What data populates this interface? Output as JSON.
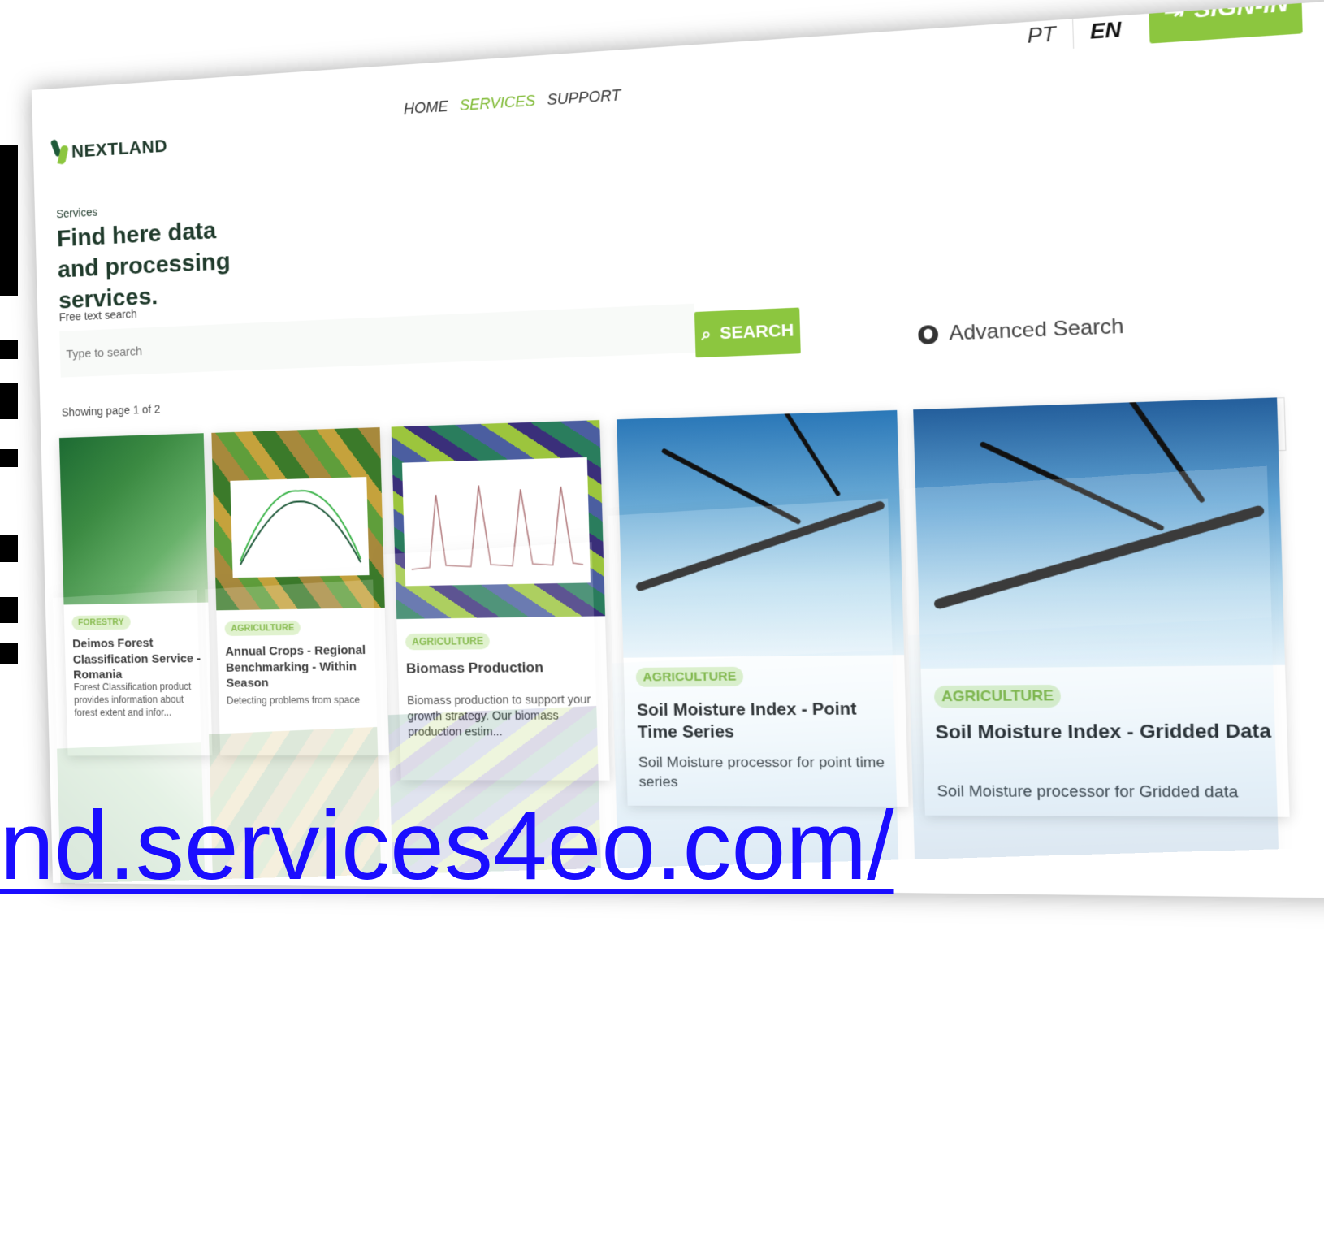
{
  "brand": {
    "logo_text": "NEXTLAND"
  },
  "nav": {
    "items": [
      "HOME",
      "SERVICES",
      "SUPPORT"
    ],
    "active": "SERVICES"
  },
  "lang": {
    "pt": "PT",
    "en": "EN"
  },
  "signin": {
    "label": "SIGN-IN"
  },
  "hero": {
    "subtitle": "Services",
    "title": "Find here data and processing services."
  },
  "search": {
    "label": "Free text search",
    "placeholder": "Type to search",
    "button": "SEARCH"
  },
  "advanced_search": {
    "label": "Advanced Search"
  },
  "paging": {
    "info": "Showing page 1 of 2",
    "current": "1",
    "next_page": "2",
    "prev": "‹",
    "next": "›",
    "page_size": "16"
  },
  "cards": [
    {
      "tag": "FORESTRY",
      "title": "Deimos Forest Classification Service - Romania",
      "desc": "Forest Classification product provides information about forest extent and infor..."
    },
    {
      "tag": "AGRICULTURE",
      "title": "Annual Crops - Regional Benchmarking - Within Season",
      "desc": "Detecting problems from space"
    },
    {
      "tag": "AGRICULTURE",
      "title": "Biomass Production",
      "desc": "Biomass production to support your growth strategy. Our biomass production estim..."
    },
    {
      "tag": "AGRICULTURE",
      "title": "Soil Moisture Index - Point Time Series",
      "desc": "Soil Moisture processor for point time series"
    },
    {
      "tag": "AGRICULTURE",
      "title": "Soil Moisture Index - Gridded Data",
      "desc": "Soil Moisture processor for Gridded data"
    }
  ],
  "url_overlay": {
    "text": "nd.services4eo.com/"
  },
  "colors": {
    "accent": "#8cc63f",
    "dark_green": "#1f3a2b",
    "link_blue": "#1a0dff"
  }
}
